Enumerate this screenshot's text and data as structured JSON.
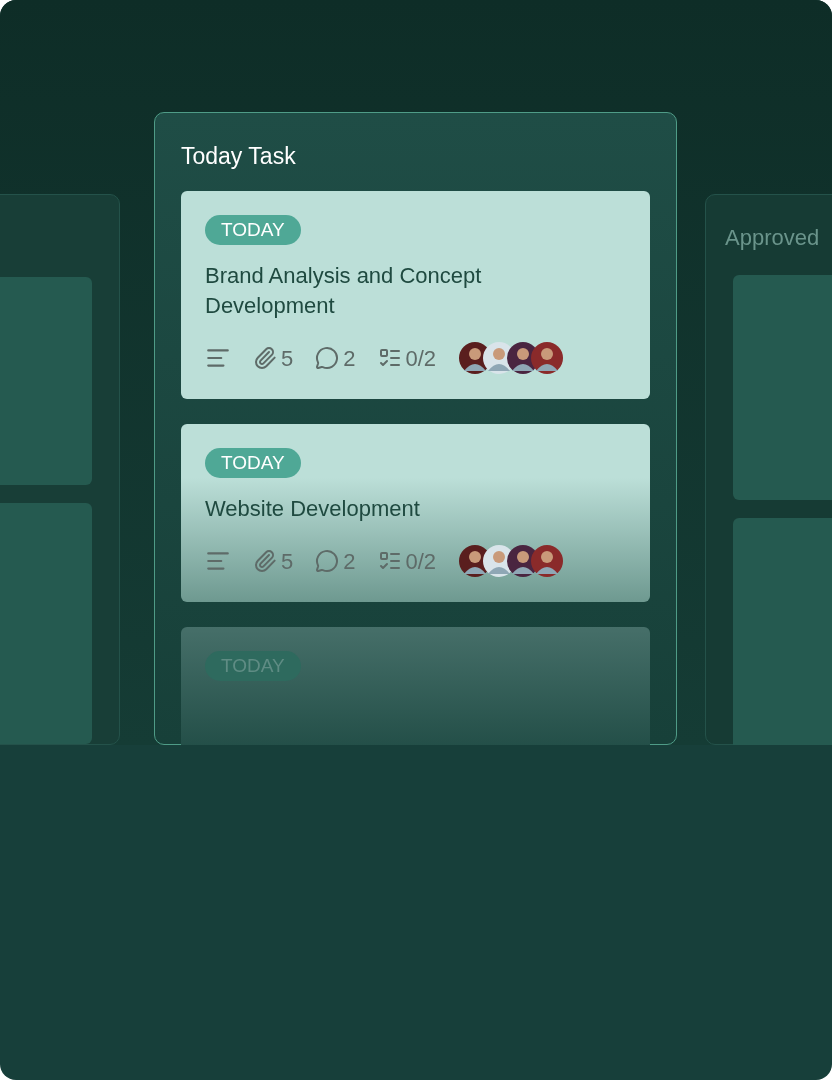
{
  "board": {
    "column": {
      "title": "Today Task",
      "cards": [
        {
          "kind": "full",
          "badge": "TODAY",
          "title": "Brand Analysis and Concept Development",
          "attachments": "5",
          "comments": "2",
          "checklist": "0/2",
          "avatars": [
            {
              "color": "#5a1e1e"
            },
            {
              "color": "#d9e4ea"
            },
            {
              "color": "#4a2540"
            },
            {
              "color": "#8a2a2a"
            }
          ]
        },
        {
          "kind": "fading",
          "badge": "TODAY",
          "title": "Website Development",
          "attachments": "5",
          "comments": "2",
          "checklist": "0/2",
          "avatars": [
            {
              "color": "#5a1e1e"
            },
            {
              "color": "#d9e4ea"
            },
            {
              "color": "#4a2540"
            },
            {
              "color": "#8a2a2a"
            }
          ]
        },
        {
          "kind": "faded",
          "badge": "TODAY"
        }
      ]
    },
    "side_column": {
      "title": "Approved"
    }
  }
}
